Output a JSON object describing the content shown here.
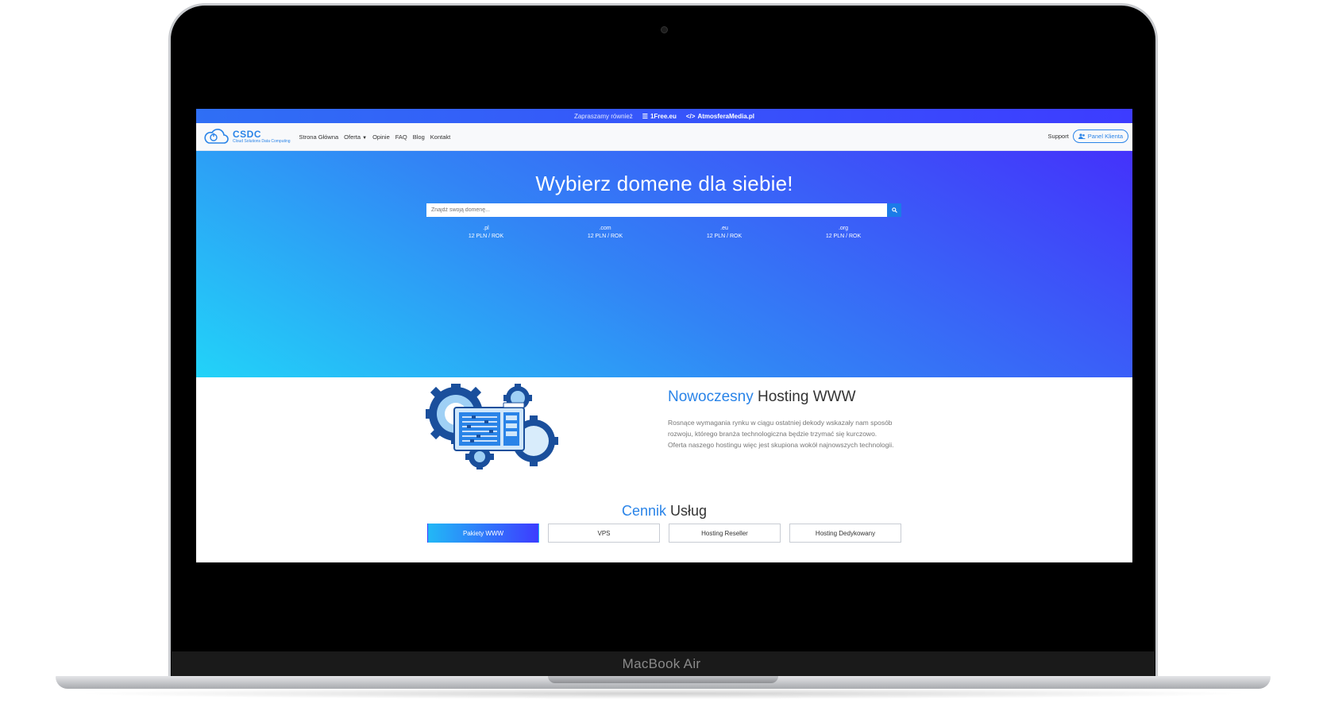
{
  "device": {
    "label": "MacBook Air"
  },
  "promo": {
    "text": "Zapraszamy również",
    "links": [
      {
        "label": "1Free.eu",
        "icon": "menu-icon"
      },
      {
        "label": "AtmosferaMedia.pl",
        "icon": "code-icon"
      }
    ]
  },
  "navbar": {
    "logo_title": "CSDC",
    "logo_subtitle": "Cloud Solutions Data Computing",
    "links": [
      "Strona Główna",
      "Oferta",
      "Opinie",
      "FAQ",
      "Blog",
      "Kontakt"
    ],
    "support": "Support",
    "panel_button": "Panel Klienta"
  },
  "hero": {
    "title": "Wybierz domene dla siebie!",
    "search_placeholder": "Znajdź swoją domenę...",
    "tlds": [
      {
        "ext": ".pl",
        "price": "12 PLN / ROK"
      },
      {
        "ext": ".com",
        "price": "12 PLN / ROK"
      },
      {
        "ext": ".eu",
        "price": "12 PLN / ROK"
      },
      {
        "ext": ".org",
        "price": "12 PLN / ROK"
      }
    ]
  },
  "feature": {
    "title_accent": "Nowoczesny",
    "title_rest": " Hosting WWW",
    "text": "Rosnące wymagania rynku w ciągu ostatniej dekody wskazały nam sposób rozwoju, którego branża technologiczna będzie trzymać się kurczowo. Oferta naszego hostingu więc jest skupiona wokół najnowszych technologii."
  },
  "pricing": {
    "title_accent": "Cennik",
    "title_rest": " Usług",
    "tabs": [
      "Pakiety WWW",
      "VPS",
      "Hosting Reseller",
      "Hosting Dedykowany"
    ],
    "active_tab": "Pakiety WWW"
  },
  "colors": {
    "accent": "#2a84e8",
    "gradient_start": "#22d3f8",
    "gradient_end": "#4432fb"
  }
}
